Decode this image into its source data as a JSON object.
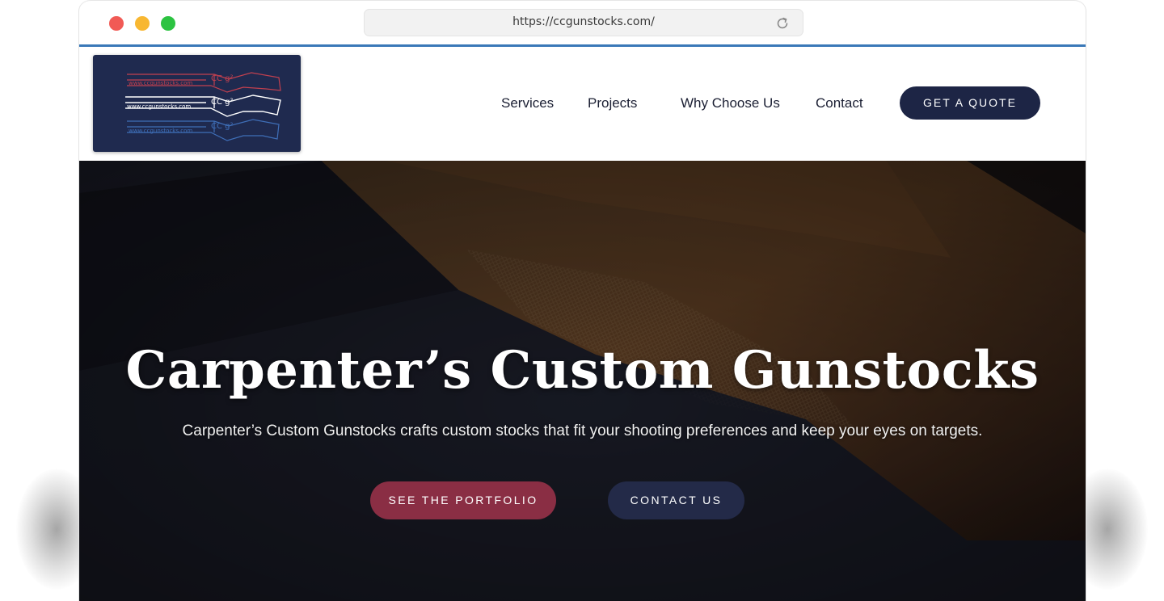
{
  "browser": {
    "url": "https://ccgunstocks.com/",
    "icons": {
      "close": "close-window-dot",
      "minimize": "minimize-window-dot",
      "maximize": "maximize-window-dot",
      "reload": "reload-icon"
    }
  },
  "logo": {
    "lines": [
      "www.ccgunstocks.com",
      "www.ccgunstocks.com",
      "www.ccgunstocks.com"
    ],
    "mark": "CC g²",
    "colors": [
      "#c2404f",
      "#ffffff",
      "#3f6fb8"
    ]
  },
  "nav": {
    "items": [
      {
        "label": "Services"
      },
      {
        "label": "Projects"
      },
      {
        "label": "Why Choose Us"
      },
      {
        "label": "Contact"
      }
    ],
    "cta_label": "GET A QUOTE"
  },
  "hero": {
    "title": "Carpenter’s Custom Gunstocks",
    "subtitle": "Carpenter’s Custom Gunstocks crafts custom stocks that fit your shooting preferences and keep your eyes on targets.",
    "primary_button": "SEE THE PORTFOLIO",
    "secondary_button": "CONTACT US"
  },
  "colors": {
    "brand_navy": "#1d2545",
    "accent_red": "#8a2e44",
    "url_underline": "#3a78b8"
  }
}
